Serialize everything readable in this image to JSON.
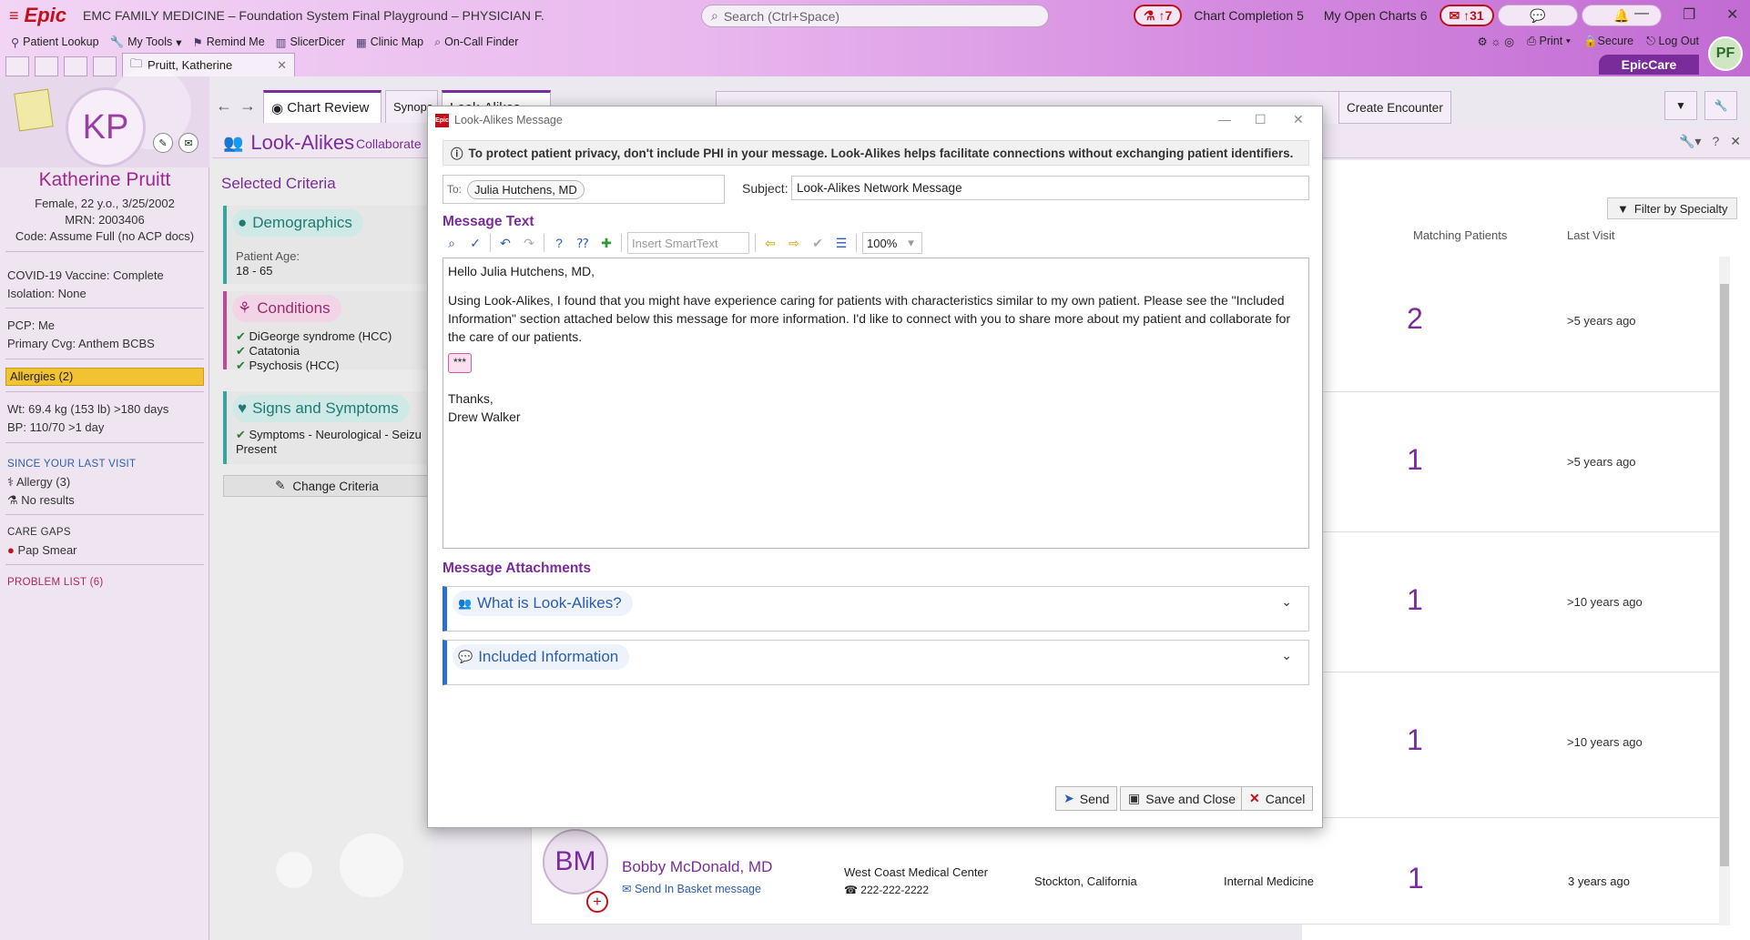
{
  "app": {
    "menu_icon": "hamburger-icon",
    "logo": "Epic",
    "title": "EMC FAMILY MEDICINE – Foundation System Final Playground – PHYSICIAN F.",
    "search_placeholder": "Search (Ctrl+Space)",
    "lab_count": "↑7",
    "chart_completion_label": "Chart Completion",
    "chart_completion_count": "5",
    "open_charts_label": "My Open Charts",
    "open_charts_count": "6",
    "inbasket_count": "↑31",
    "user_initials": "PF",
    "epiccare_label": "EpicCare"
  },
  "toolbar": {
    "patient_lookup": "Patient Lookup",
    "my_tools": "My Tools",
    "remind_me": "Remind Me",
    "slicerdicer": "SlicerDicer",
    "clinic_map": "Clinic Map",
    "on_call_finder": "On-Call Finder",
    "print": "Print",
    "secure": "Secure",
    "log_out": "Log Out"
  },
  "patient_tab": {
    "label": "Pruitt, Katherine"
  },
  "patient": {
    "initials": "KP",
    "name": "Katherine Pruitt",
    "demographics": "Female, 22 y.o., 3/25/2002",
    "mrn": "MRN: 2003406",
    "code": "Code: Assume Full (no ACP docs)",
    "covid": "COVID-19 Vaccine: Complete",
    "isolation": "Isolation: None",
    "pcp": "PCP: Me",
    "coverage": "Primary Cvg: Anthem BCBS",
    "allergies": "Allergies (2)",
    "weight": "Wt:  69.4 kg (153 lb) >180 days",
    "bp": "BP:  110/70 >1 day",
    "since_last_visit": "SINCE YOUR LAST VISIT",
    "allergy_count": "Allergy (3)",
    "no_results": "No results",
    "care_gaps": "CARE GAPS",
    "pap_smear": "Pap Smear",
    "problem_list": "PROBLEM LIST (6)"
  },
  "activity_tabs": {
    "chart_review": "Chart Review",
    "synopsis": "Synops",
    "look_alikes": "Look-Alikes",
    "create_encounter": "Create Encounter"
  },
  "look_alikes": {
    "title": "Look-Alikes",
    "subtitle": "Collaborate",
    "selected_criteria": "Selected Criteria",
    "demographics": "Demographics",
    "patient_age_label": "Patient Age:",
    "patient_age_value": "18 - 65",
    "conditions": "Conditions",
    "condition_items": [
      "DiGeorge syndrome (HCC)",
      "Catatonia",
      "Psychosis (HCC)"
    ],
    "signs": "Signs and Symptoms",
    "sign_items": [
      "Symptoms - Neurological - Seizu",
      "Present"
    ],
    "change_criteria": "Change Criteria",
    "filter_by_specialty": "Filter by Specialty",
    "col_matching": "Matching Patients",
    "col_last_visit": "Last Visit",
    "rows": [
      {
        "matching": "2",
        "last_visit": ">5 years ago"
      },
      {
        "matching": "1",
        "last_visit": ">5 years ago"
      },
      {
        "matching": "1",
        "last_visit": ">10 years ago"
      },
      {
        "matching": "1",
        "last_visit": ">10 years ago"
      },
      {
        "matching": "1",
        "last_visit": "3 years ago"
      }
    ],
    "provider": {
      "initials": "BM",
      "name": "Bobby McDonald, MD",
      "send_link": "Send In Basket message",
      "org": "West Coast Medical Center",
      "phone": "222-222-2222",
      "location": "Stockton, California",
      "specialty": "Internal Medicine"
    }
  },
  "dialog": {
    "title": "Look-Alikes Message",
    "privacy": "To protect patient privacy, don't include PHI in your message. Look-Alikes helps facilitate connections without exchanging patient identifiers.",
    "to_label": "To:",
    "to_recipient": "Julia Hutchens, MD",
    "subject_label": "Subject:",
    "subject_value": "Look-Alikes Network Message",
    "message_text_label": "Message Text",
    "smarttext_placeholder": "Insert SmartText",
    "zoom": "100%",
    "greeting": "Hello Julia Hutchens, MD,",
    "body": "Using Look-Alikes, I found that you might have experience caring for patients with characteristics similar to my own patient. Please see the \"Included Information\" section attached below this message for more information. I'd like to connect with you to share more about my patient and collaborate for the care of our patients.",
    "wildcard": "***",
    "thanks": "Thanks,",
    "signature": "Drew Walker",
    "attachments_label": "Message Attachments",
    "what_is": "What is Look-Alikes?",
    "included": "Included Information",
    "send": "Send",
    "save_close": "Save and Close",
    "cancel": "Cancel"
  },
  "colors": {
    "brand_purple": "#7a2c9a",
    "epic_red": "#c0101a",
    "allergy_yellow": "#f1c232",
    "link_blue": "#2a5db0"
  }
}
